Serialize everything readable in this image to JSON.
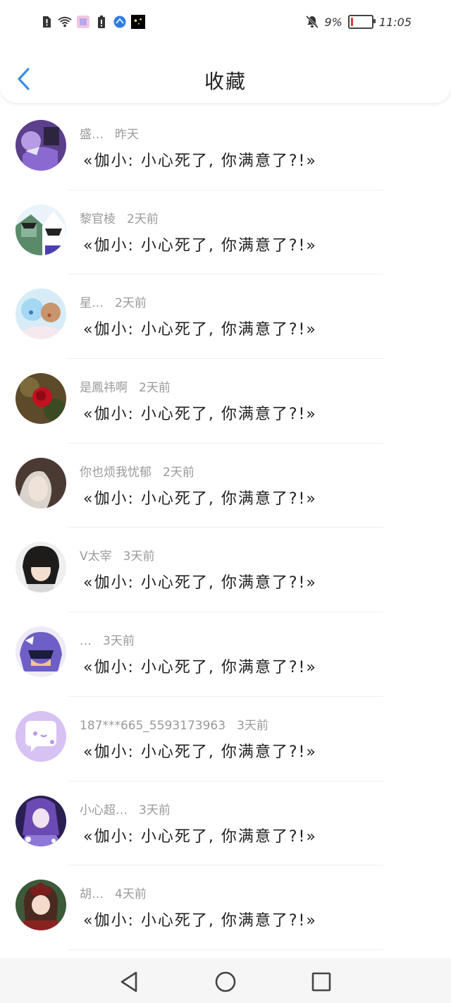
{
  "status_bar": {
    "battery_percent": "9%",
    "time": "11:05",
    "battery_level": 0.09
  },
  "header": {
    "title": "收藏"
  },
  "favorites": [
    {
      "name": "盛…",
      "time": "昨天",
      "quote": "«伽小: 小心死了, 你满意了?!»"
    },
    {
      "name": "黎官棱",
      "time": "2天前",
      "quote": "«伽小: 小心死了, 你满意了?!»"
    },
    {
      "name": "星…",
      "time": "2天前",
      "quote": "«伽小: 小心死了, 你满意了?!»"
    },
    {
      "name": "是鳳祎啊",
      "time": "2天前",
      "quote": "«伽小: 小心死了, 你满意了?!»"
    },
    {
      "name": "你也烦我忧郁",
      "time": "2天前",
      "quote": "«伽小: 小心死了, 你满意了?!»"
    },
    {
      "name": "V太宰",
      "time": "3天前",
      "quote": "«伽小: 小心死了, 你满意了?!»"
    },
    {
      "name": "…",
      "time": "3天前",
      "quote": "«伽小: 小心死了, 你满意了?!»"
    },
    {
      "name": "187***665_5593173963",
      "time": "3天前",
      "quote": "«伽小: 小心死了, 你满意了?!»"
    },
    {
      "name": "小心超…",
      "time": "3天前",
      "quote": "«伽小: 小心死了, 你满意了?!»"
    },
    {
      "name": "胡…",
      "time": "4天前",
      "quote": "«伽小: 小心死了, 你满意了?!»"
    }
  ],
  "colors": {
    "accent": "#3a8ee6",
    "meta_text": "#9a9a9a"
  }
}
